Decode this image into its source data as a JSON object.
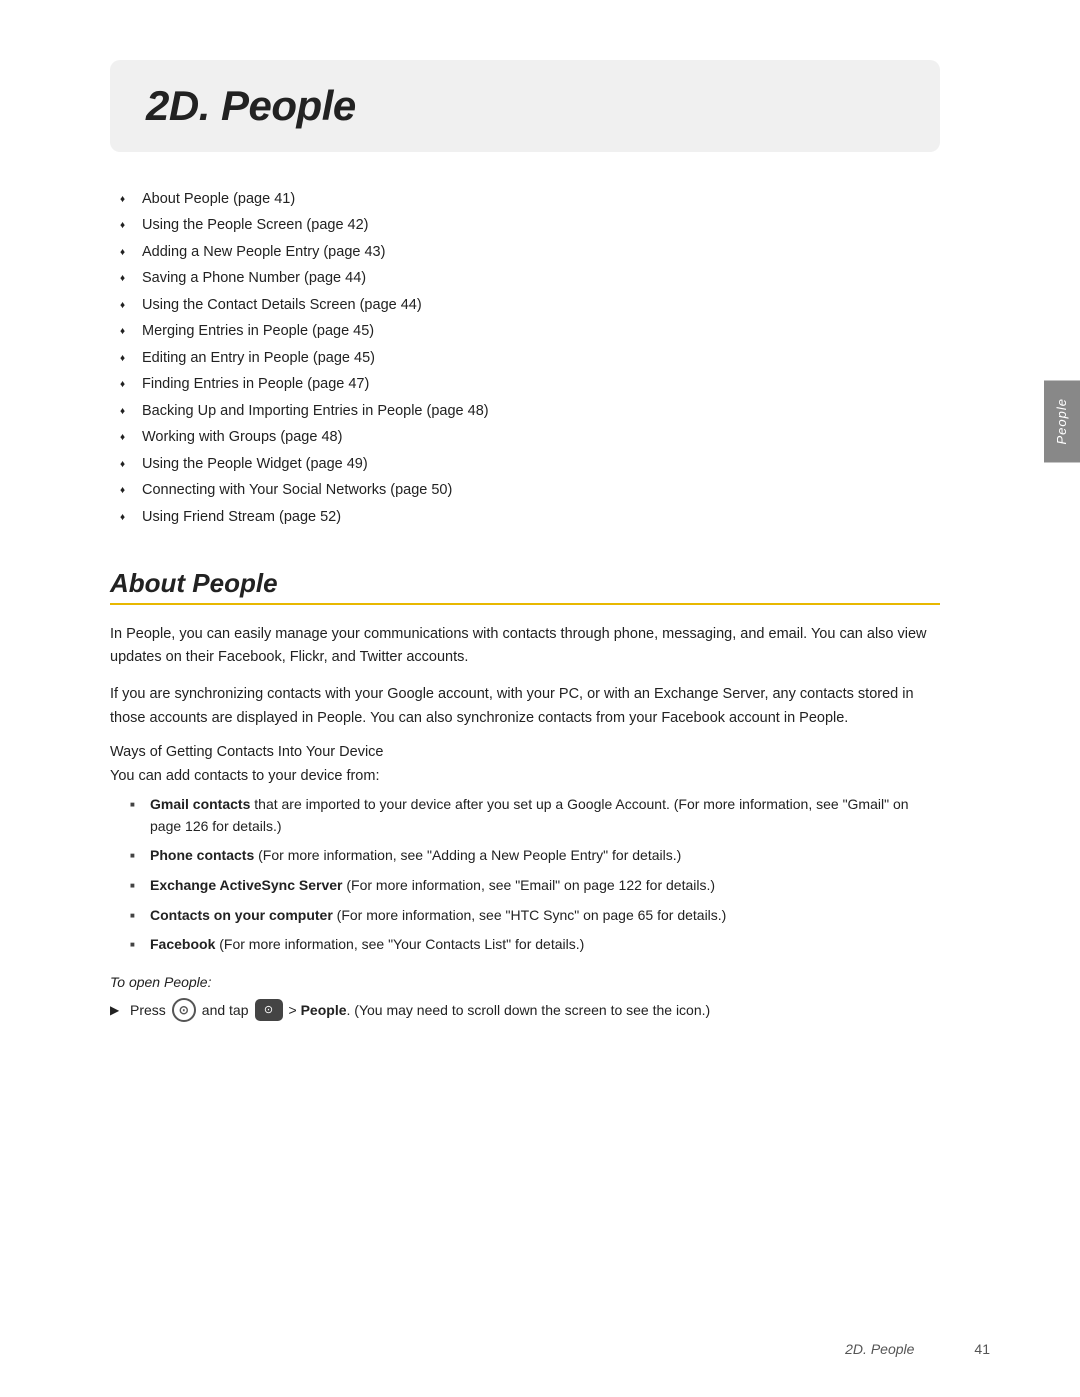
{
  "chapter": {
    "title": "2D. People"
  },
  "toc": {
    "items": [
      "About People (page 41)",
      "Using the People Screen (page 42)",
      "Adding a New People Entry (page 43)",
      "Saving a Phone Number (page 44)",
      "Using the Contact Details Screen (page 44)",
      "Merging Entries in People (page 45)",
      "Editing an Entry in People (page 45)",
      "Finding Entries in People (page 47)",
      "Backing Up and Importing Entries in People (page 48)",
      "Working with Groups (page 48)",
      "Using the People Widget (page 49)",
      "Connecting with Your Social Networks (page 50)",
      "Using Friend Stream (page 52)"
    ]
  },
  "section": {
    "title": "About People"
  },
  "body": {
    "para1": "In People, you can easily manage your communications with contacts through phone, messaging, and email. You can also view updates on their Facebook, Flickr, and Twitter accounts.",
    "para2": "If you are synchronizing contacts with your Google account, with your PC, or with an Exchange Server, any contacts stored in those accounts are displayed in People. You can also synchronize contacts from your Facebook account in People.",
    "subheading1": "Ways of Getting Contacts Into Your Device",
    "subheading2": "You can add contacts to your device from:",
    "bullets": [
      {
        "bold": "Gmail contacts",
        "normal": " that are imported to your device after you set up a Google Account. (For more information, see \"Gmail\" on page 126 for details.)"
      },
      {
        "bold": "Phone contacts",
        "normal": " (For more information, see \"Adding a New People Entry\" for details.)"
      },
      {
        "bold": "Exchange ActiveSync Server",
        "normal": " (For more information, see \"Email\" on page 122 for details.)"
      },
      {
        "bold": "Contacts on your computer",
        "normal": " (For more information, see \"HTC Sync\" on page 65 for details.)"
      },
      {
        "bold": "Facebook",
        "normal": " (For more information, see \"Your Contacts List\" for details.)"
      }
    ],
    "to_open_label": "To open People:",
    "instruction_prefix": "Press",
    "instruction_icon1": "⊙",
    "instruction_middle": "and tap",
    "instruction_icon2": "⊙",
    "instruction_suffix": "> People. (You may need to scroll down the screen to see the icon.)"
  },
  "side_tab": {
    "label": "People"
  },
  "footer": {
    "chapter_label": "2D. People",
    "page_number": "41"
  }
}
